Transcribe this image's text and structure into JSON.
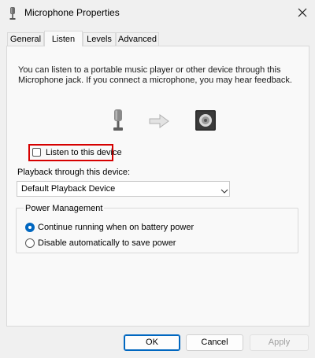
{
  "window": {
    "title": "Microphone Properties",
    "title_icon": "microphone-icon",
    "close_icon": "close-icon"
  },
  "tabs": [
    {
      "label": "General",
      "active": false
    },
    {
      "label": "Listen",
      "active": true
    },
    {
      "label": "Levels",
      "active": false
    },
    {
      "label": "Advanced",
      "active": false
    }
  ],
  "listen": {
    "description": "You can listen to a portable music player or other device through this Microphone jack.  If you connect a microphone, you may hear feedback.",
    "icons": [
      "microphone-icon",
      "arrow-right-icon",
      "speaker-icon"
    ],
    "listen_checkbox": {
      "label": "Listen to this device",
      "checked": false
    },
    "playback_label": "Playback through this device:",
    "playback_device": "Default Playback Device",
    "power_group_title": "Power Management",
    "power_options": [
      {
        "label": "Continue running when on battery power",
        "selected": true
      },
      {
        "label": "Disable automatically to save power",
        "selected": false
      }
    ]
  },
  "buttons": {
    "ok": "OK",
    "cancel": "Cancel",
    "apply": "Apply"
  },
  "colors": {
    "accent": "#0067c0",
    "highlight_box": "#d60000"
  }
}
